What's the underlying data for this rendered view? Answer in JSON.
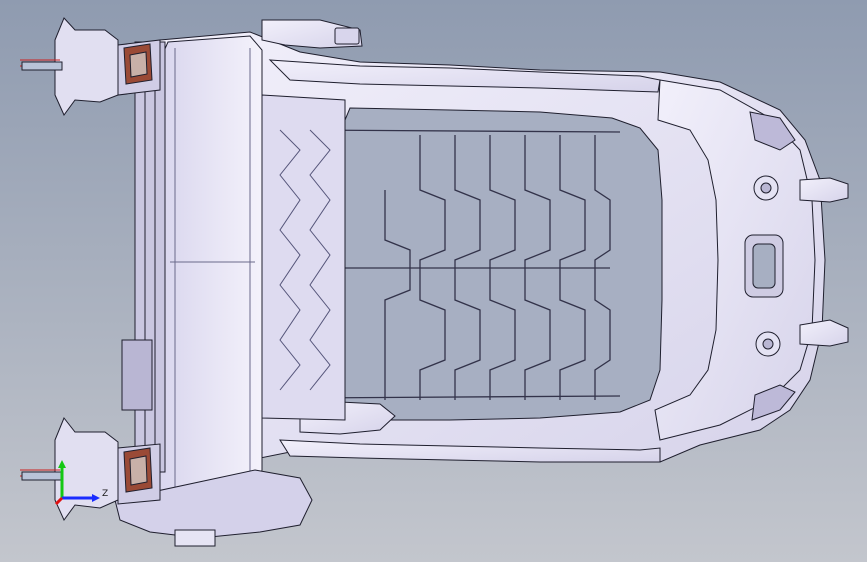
{
  "viewport": {
    "background_top": "#8f9bb0",
    "background_bottom": "#c3c6cd",
    "model_fill": "#ebe9f7",
    "model_stroke": "#1f1f2e",
    "bracket_color": "#8a3a2a"
  },
  "triad": {
    "z_label": "Z",
    "x_color": "#1a2cff",
    "y_color": "#14c814",
    "z_color": "#e01010"
  }
}
